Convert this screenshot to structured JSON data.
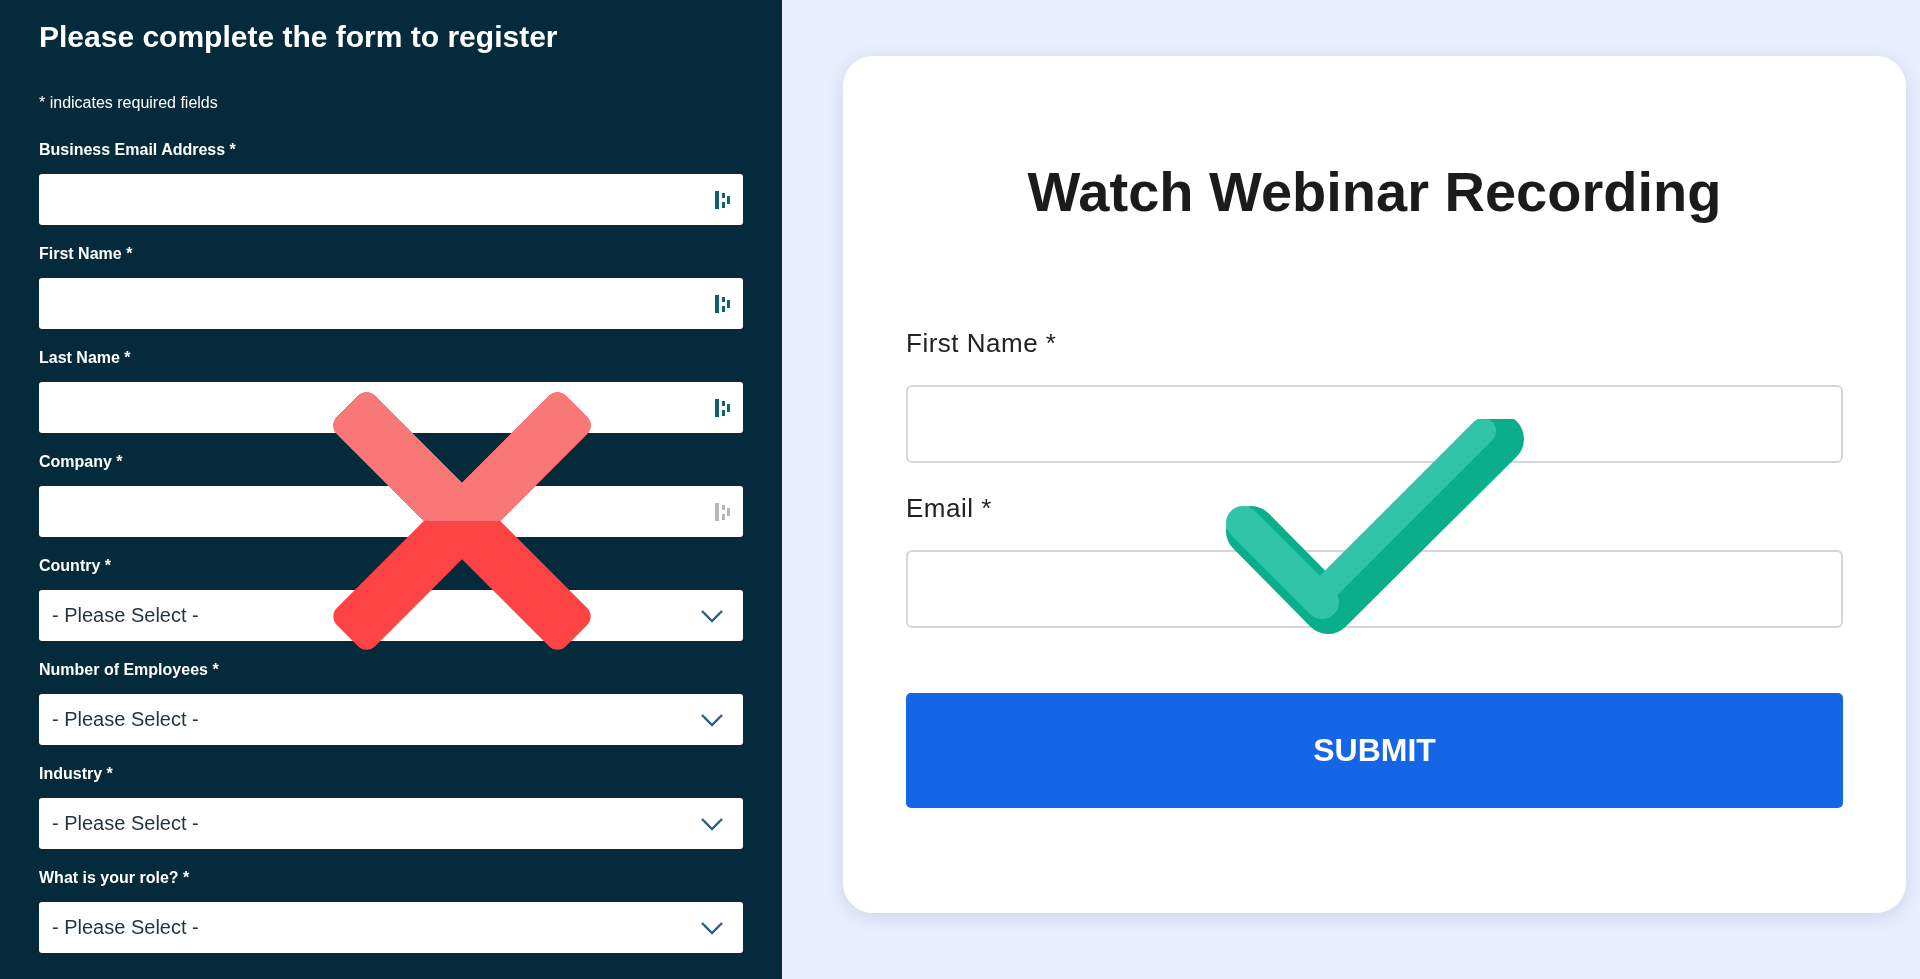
{
  "left_form": {
    "overlay": {
      "kind": "cross"
    },
    "title": "Please complete the form to register",
    "note": "* indicates required fields",
    "fields": [
      {
        "kind": "text",
        "label": "Business Email Address *",
        "icon_active": true
      },
      {
        "kind": "text",
        "label": "First Name *",
        "icon_active": true
      },
      {
        "kind": "text",
        "label": "Last Name *",
        "icon_active": true
      },
      {
        "kind": "text",
        "label": "Company *",
        "icon_active": false
      },
      {
        "kind": "select",
        "label": "Country *",
        "value": "- Please Select -"
      },
      {
        "kind": "select",
        "label": "Number of Employees *",
        "value": "- Please Select -"
      },
      {
        "kind": "select",
        "label": "Industry *",
        "value": "- Please Select -"
      },
      {
        "kind": "select",
        "label": "What is your role? *",
        "value": "- Please Select -"
      }
    ]
  },
  "right_form": {
    "overlay": {
      "kind": "check"
    },
    "title": "Watch Webinar Recording",
    "fields": [
      {
        "label": "First Name *"
      },
      {
        "label": "Email *"
      }
    ],
    "submit": "SUBMIT"
  }
}
